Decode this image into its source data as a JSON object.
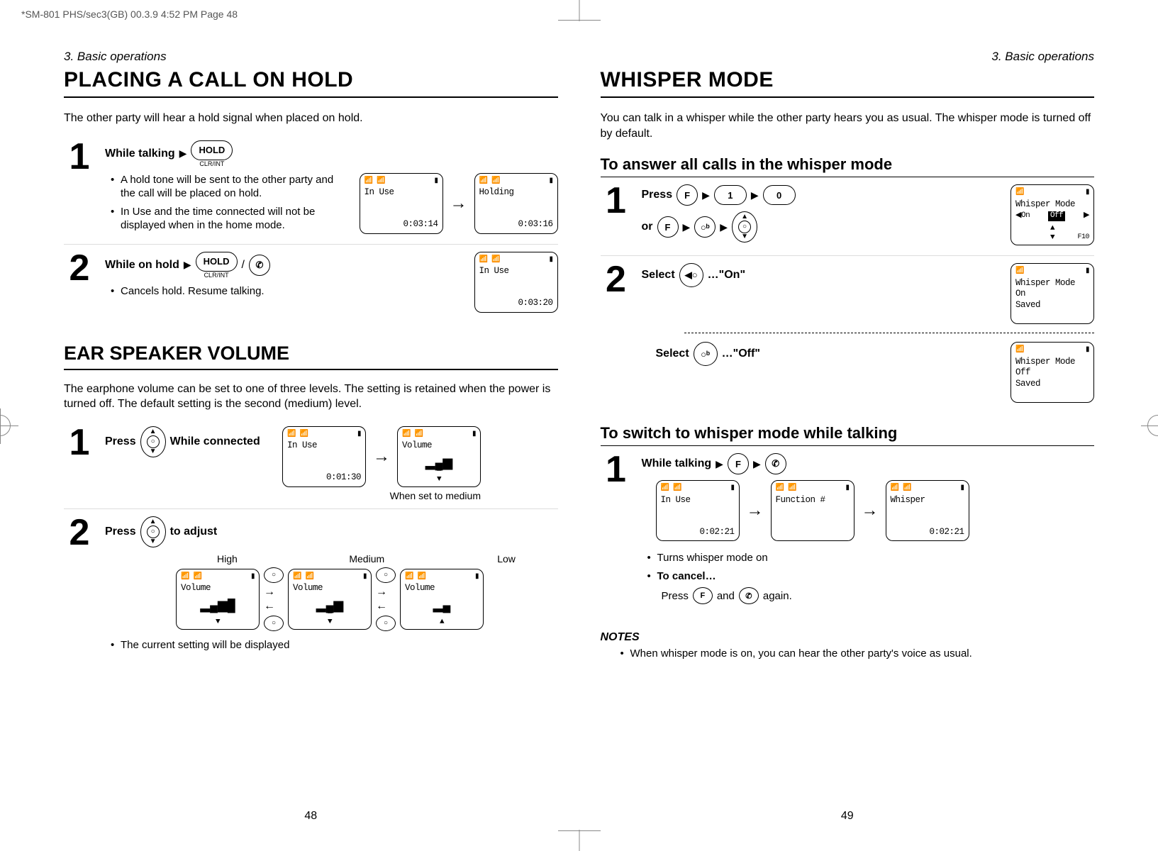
{
  "print_header": "*SM-801 PHS/sec3(GB)  00.3.9 4:52 PM  Page 48",
  "left": {
    "chapter": "3. Basic operations",
    "h1": "PLACING A CALL ON HOLD",
    "intro": "The other party will hear a hold signal when placed on hold.",
    "step1": {
      "label": "While talking",
      "hold_key": "HOLD",
      "hold_sub": "CLR/INT",
      "b1": "A hold tone will be sent to the other party and the call will be placed on hold.",
      "b2": "In Use and the time connected will not be displayed when in the home mode.",
      "scr1_l1": "In Use",
      "scr1_t": "0:03:14",
      "scr2_l1": "Holding",
      "scr2_t": "0:03:16"
    },
    "step2": {
      "label": "While on hold",
      "hold_key": "HOLD",
      "hold_sub": "CLR/INT",
      "b1": "Cancels hold. Resume talking.",
      "scr_l1": "In Use",
      "scr_t": "0:03:20"
    },
    "h2": "EAR SPEAKER VOLUME",
    "intro2": "The earphone volume can be set to one of three levels. The setting is retained when the power is turned off. The default setting is the second (medium) level.",
    "vstep1": {
      "press": "Press",
      "while": "While connected",
      "scr1_l1": "In Use",
      "scr1_t": "0:01:30",
      "scr2_l1": "Volume",
      "vol_med": "▂▄▆",
      "caption": "When set to medium"
    },
    "vstep2": {
      "press": "Press",
      "to": "to adjust",
      "high": "High",
      "medium": "Medium",
      "low": "Low",
      "vol_label": "Volume",
      "vol_high": "▂▄▆█",
      "vol_med": "▂▄▆",
      "vol_low": "▂▄",
      "note": "The current setting will be displayed"
    },
    "pgnum": "48"
  },
  "right": {
    "chapter": "3. Basic operations",
    "h1": "WHISPER MODE",
    "intro": "You can talk in a whisper while the other party hears you as usual. The whisper mode is turned off by default.",
    "sub1": "To answer all calls in the whisper mode",
    "w1": {
      "press": "Press",
      "f": "F",
      "one": "1",
      "zero": "0",
      "or": "or",
      "oB": "○ᵇ",
      "scr_l1": "Whisper Mode",
      "scr_on": "On",
      "scr_off": "Off",
      "scr_side": "F10",
      "speaker": "🔈On"
    },
    "w2": {
      "select": "Select",
      "on": "…\"On\"",
      "off": "…\"Off\"",
      "scr1_l1": "Whisper Mode",
      "scr1_l2": "On",
      "scr1_l3": "Saved",
      "scr2_l1": "Whisper Mode",
      "scr2_l2": "Off",
      "scr2_l3": "Saved"
    },
    "sub2": "To switch to whisper mode while talking",
    "t1": {
      "while": "While talking",
      "f": "F",
      "scr1_l1": "In Use",
      "scr1_t": "0:02:21",
      "scr2_l1": "Function #",
      "scr3_l1": "Whisper",
      "scr3_t": "0:02:21",
      "b1": "Turns whisper mode on",
      "b2": "To cancel…",
      "cancel": "Press ",
      "again": " again.",
      "and": " and "
    },
    "notes_h": "NOTES",
    "note1": "When whisper mode is on, you can hear the other party's voice as usual.",
    "pgnum": "49"
  }
}
